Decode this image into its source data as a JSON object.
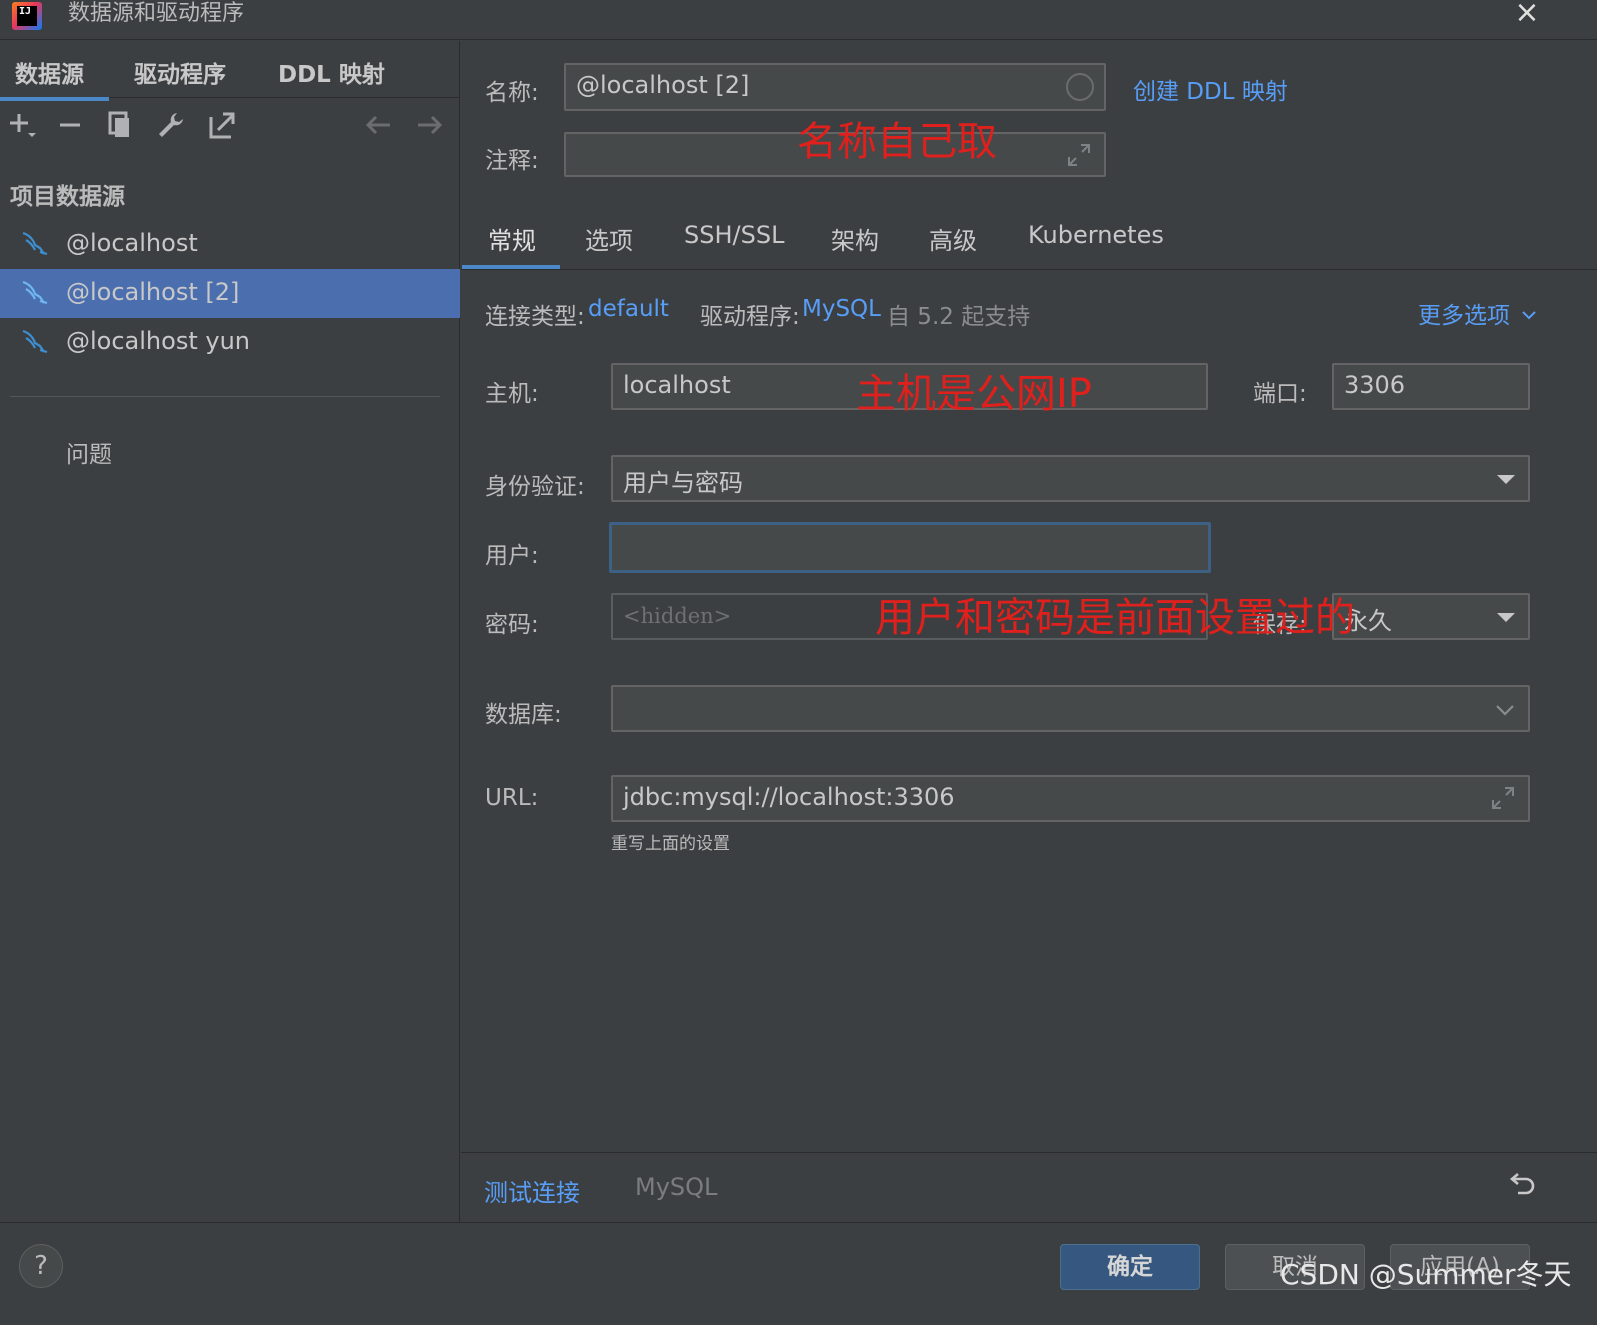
{
  "window": {
    "title": "数据源和驱动程序",
    "close_icon": "×"
  },
  "left": {
    "tabs": [
      "数据源",
      "驱动程序",
      "DDL 映射"
    ],
    "toolbar": {
      "add": "+",
      "remove": "−",
      "copy": "⧉",
      "wrench": "🔧",
      "export": "↗",
      "back": "←",
      "forward": "→"
    },
    "section_title": "项目数据源",
    "datasources": [
      "@localhost",
      "@localhost [2]",
      "@localhost yun"
    ],
    "selected_index": 1,
    "issues_label": "问题"
  },
  "form": {
    "name_label": "名称:",
    "name_value": "@localhost [2]",
    "create_ddl_link": "创建 DDL 映射",
    "comment_label": "注释:",
    "comment_value": "",
    "tabs": [
      "常规",
      "选项",
      "SSH/SSL",
      "架构",
      "高级",
      "Kubernetes"
    ],
    "active_tab": 0,
    "conn_type_label": "连接类型:",
    "conn_type_value": "default",
    "driver_label": "驱动程序:",
    "driver_value": "MySQL",
    "driver_note": "自 5.2 起支持",
    "more_options": "更多选项",
    "host_label": "主机:",
    "host_value": "localhost",
    "port_label": "端口:",
    "port_value": "3306",
    "auth_label": "身份验证:",
    "auth_value": "用户与密码",
    "user_label": "用户:",
    "user_value": "",
    "password_label": "密码:",
    "password_placeholder": "<hidden>",
    "save_label": "保存:",
    "save_value": "永久",
    "database_label": "数据库:",
    "database_value": "",
    "url_label": "URL:",
    "url_value": "jdbc:mysql://localhost:3306",
    "url_hint": "重写上面的设置"
  },
  "annotations": {
    "name_note": "名称自己取",
    "host_note": "主机是公网IP",
    "user_note": "用户和密码是前面设置过的"
  },
  "bottom": {
    "test_connection": "测试连接",
    "driver_name": "MySQL",
    "revert_icon": "⟲"
  },
  "footer": {
    "help": "?",
    "ok": "确定",
    "cancel": "取消",
    "apply": "应用(A)",
    "watermark": "CSDN @Summer冬天"
  },
  "colors": {
    "accent": "#4a88c7",
    "link": "#589df6",
    "selected": "#4b6eaf",
    "annotation": "#e0201c",
    "background": "#3c3f41"
  }
}
